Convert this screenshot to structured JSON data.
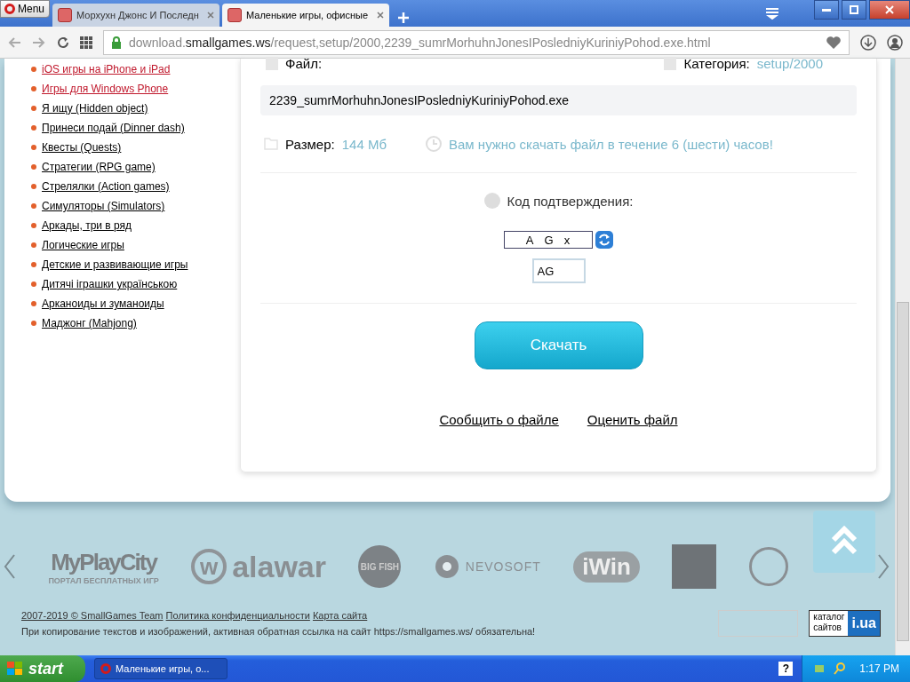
{
  "browser": {
    "menu_label": "Menu",
    "tabs": [
      {
        "title": "Морхухн Джонс И Последн",
        "selected": false
      },
      {
        "title": "Маленькие игры, офисные",
        "selected": true
      }
    ],
    "address": {
      "prefix": "download.",
      "domain": "smallgames.ws",
      "path": "/request,setup/2000,2239_sumrMorhuhnJonesIPosledniyKuriniyPohod.exe.html"
    }
  },
  "sidebar": {
    "items": [
      {
        "label": "iOS игры на iPhone и iPad",
        "highlighted": true
      },
      {
        "label": "Игры для Windows Phone",
        "highlighted": true
      },
      {
        "label": "Я ищу (Hidden object)",
        "highlighted": false
      },
      {
        "label": "Принеси подай (Dinner dash)",
        "highlighted": false
      },
      {
        "label": "Квесты (Quests)",
        "highlighted": false
      },
      {
        "label": "Стратегии (RPG game)",
        "highlighted": false
      },
      {
        "label": "Стрелялки (Action games)",
        "highlighted": false
      },
      {
        "label": "Симуляторы (Simulators)",
        "highlighted": false
      },
      {
        "label": "Аркады, три в ряд",
        "highlighted": false
      },
      {
        "label": "Логические игры",
        "highlighted": false
      },
      {
        "label": "Детские и развивающие игры",
        "highlighted": false
      },
      {
        "label": "Дитячі іграшки українською",
        "highlighted": false
      },
      {
        "label": "Арканоиды и зуманоиды",
        "highlighted": false
      },
      {
        "label": "Маджонг (Mahjong)",
        "highlighted": false
      }
    ]
  },
  "download": {
    "file_label": "Файл:",
    "category_label": "Категория:",
    "category_value": "setup/2000",
    "filename": "2239_sumrMorhuhnJonesIPosledniyKuriniyPohod.exe",
    "size_label": "Размер:",
    "size_value": "144 Мб",
    "notice": "Вам нужно скачать файл в течение 6 (шести) часов!",
    "captcha_label": "Код подтверждения:",
    "captcha_letters": [
      "A",
      "G",
      "x"
    ],
    "captcha_input": {
      "value": "AG"
    },
    "button": "Скачать",
    "links": [
      "Сообщить о файле",
      "Оценить файл"
    ]
  },
  "partners": [
    {
      "kind": "city",
      "name": "MyPlayCity",
      "caption": "ПОРТАЛ БЕСПЛАТНЫХ ИГР"
    },
    {
      "kind": "alawar",
      "name": "alawar",
      "mark": "w"
    },
    {
      "kind": "bigfish",
      "name": "BIG FISH"
    },
    {
      "kind": "nevosoft",
      "name": "NEVOSOFT"
    },
    {
      "kind": "iwin",
      "name": "iWin"
    },
    {
      "kind": "square"
    },
    {
      "kind": "round"
    }
  ],
  "footer": {
    "copyright": "2007-2019 © SmallGames Team",
    "links": [
      "Политика конфиденциальности",
      "Карта сайта"
    ],
    "notice": "При копирование текстов и изображений, активная обратная ссылка на сайт https://smallgames.ws/ обязательна!",
    "badge_top": "каталог",
    "badge_bottom": "сайтов",
    "badge_logo": "i.ua"
  },
  "taskbar": {
    "start": "start",
    "help": "?",
    "tasks": [
      {
        "title": "Маленькие игры, о...",
        "selected": true
      }
    ],
    "clock": "1:17 PM"
  }
}
